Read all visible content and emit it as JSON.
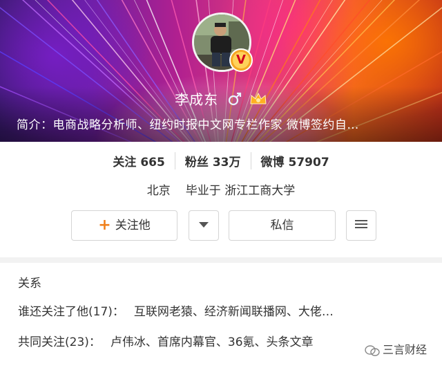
{
  "profile": {
    "name": "李成东",
    "intro": "简介：电商战略分析师、纽约时报中文网专栏作家 微博签约自…",
    "verified_badge": "V",
    "icons": [
      "male-gender-icon",
      "vip-crown-icon"
    ],
    "colors": {
      "banner_accent": "#f0641e",
      "follow_plus": "#f07f1a",
      "badge": "#f5a623"
    }
  },
  "stats": [
    {
      "label": "关注",
      "value": "665"
    },
    {
      "label": "粉丝",
      "value": "33万"
    },
    {
      "label": "微博",
      "value": "57907"
    }
  ],
  "location": {
    "city": "北京",
    "school_prefix": "毕业于",
    "school": "浙江工商大学"
  },
  "actions": {
    "follow_plus": "+",
    "follow_label": "关注他",
    "message_label": "私信"
  },
  "relations": {
    "title": "关系",
    "followers_label": "谁还关注了他(17)：",
    "followers_names": "互联网老猿、经济新闻联播网、大佬…",
    "mutual_label": "共同关注(23)：",
    "mutual_names": "卢伟冰、首席内幕官、36氪、头条文章"
  },
  "watermark": "三言财经"
}
